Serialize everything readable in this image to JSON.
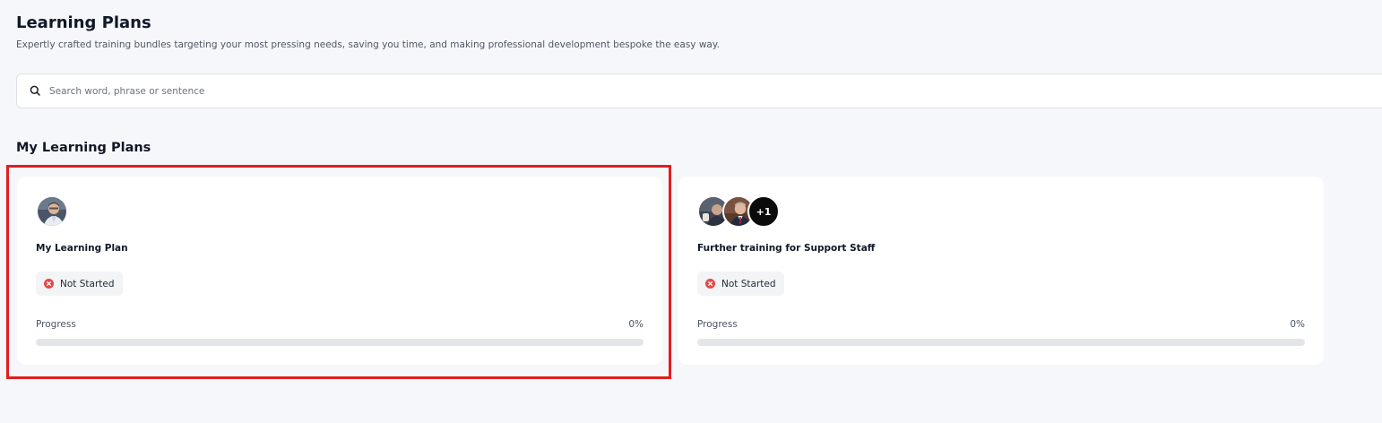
{
  "header": {
    "title": "Learning Plans",
    "subtitle": "Expertly crafted training bundles targeting your most pressing needs, saving you time, and making professional development bespoke the easy way."
  },
  "search": {
    "placeholder": "Search word, phrase or sentence",
    "value": "",
    "icon": "search-icon"
  },
  "section": {
    "title": "My Learning Plans"
  },
  "plans": [
    {
      "title": "My Learning Plan",
      "status": "Not Started",
      "progress_label": "Progress",
      "progress_value": "0%",
      "progress_fraction": 0,
      "avatars": [
        "person-avatar"
      ],
      "highlighted": true
    },
    {
      "title": "Further training for Support Staff",
      "status": "Not Started",
      "progress_label": "Progress",
      "progress_value": "0%",
      "progress_fraction": 0,
      "avatars": [
        "person-avatar",
        "person-avatar"
      ],
      "extra_count": "+1",
      "highlighted": false
    }
  ],
  "colors": {
    "highlight": "#e01e1e",
    "status_error": "#e24b4b",
    "background": "#f6f7fa",
    "card": "#ffffff"
  }
}
